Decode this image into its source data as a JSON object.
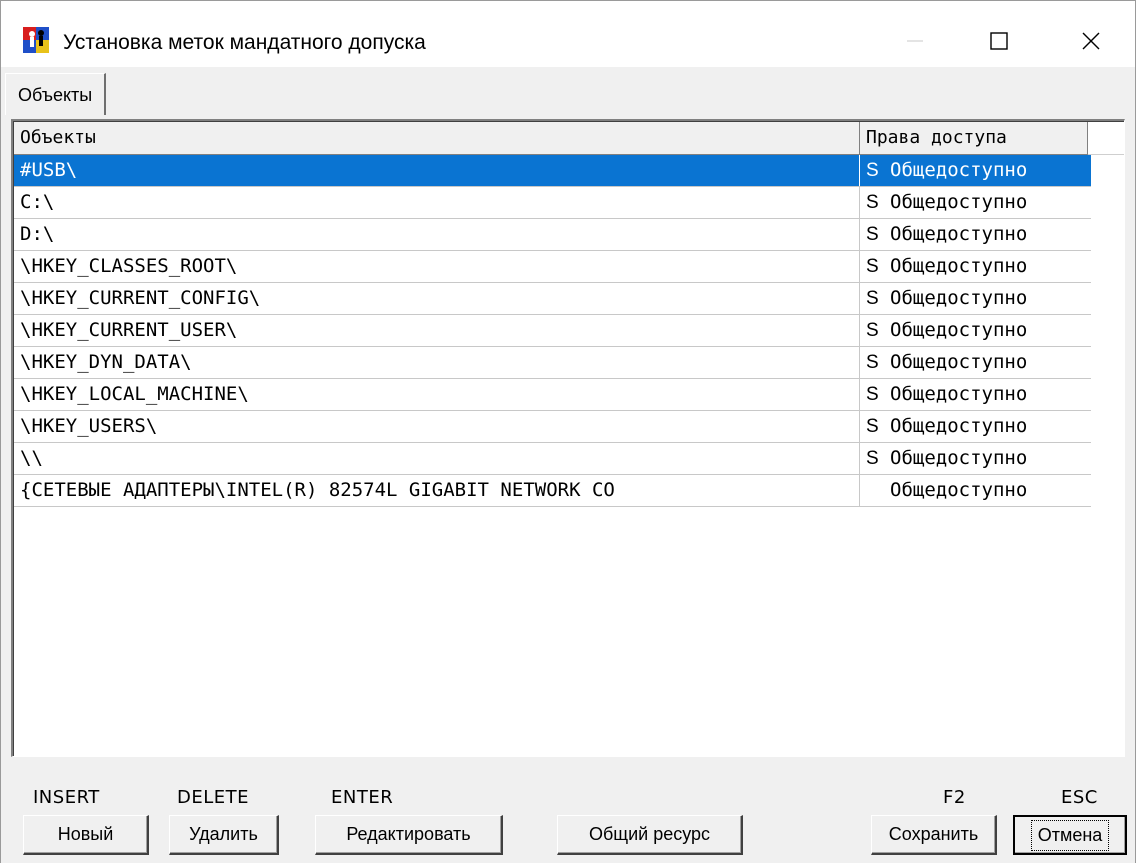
{
  "window": {
    "title": "Установка меток мандатного допуска"
  },
  "tabs": [
    {
      "label": "Объекты",
      "active": true
    }
  ],
  "grid": {
    "columns": {
      "objects": "Объекты",
      "rights": "Права доступа"
    },
    "rows": [
      {
        "object": "#USB\\",
        "flag": "S",
        "rights": "Общедоступно",
        "selected": true
      },
      {
        "object": "C:\\",
        "flag": "S",
        "rights": "Общедоступно"
      },
      {
        "object": "D:\\",
        "flag": "S",
        "rights": "Общедоступно"
      },
      {
        "object": "\\HKEY_CLASSES_ROOT\\",
        "flag": "S",
        "rights": "Общедоступно"
      },
      {
        "object": "\\HKEY_CURRENT_CONFIG\\",
        "flag": "S",
        "rights": "Общедоступно"
      },
      {
        "object": "\\HKEY_CURRENT_USER\\",
        "flag": "S",
        "rights": "Общедоступно"
      },
      {
        "object": "\\HKEY_DYN_DATA\\",
        "flag": "S",
        "rights": "Общедоступно"
      },
      {
        "object": "\\HKEY_LOCAL_MACHINE\\",
        "flag": "S",
        "rights": "Общедоступно"
      },
      {
        "object": "\\HKEY_USERS\\",
        "flag": "S",
        "rights": "Общедоступно"
      },
      {
        "object": "\\\\",
        "flag": "S",
        "rights": "Общедоступно"
      },
      {
        "object": "{СЕТЕВЫЕ АДАПТЕРЫ\\INTEL(R) 82574L GIGABIT NETWORK CO",
        "flag": "",
        "rights": "Общедоступно"
      }
    ]
  },
  "bottom": {
    "keys": {
      "insert": "INSERT",
      "delete": "DELETE",
      "enter": "ENTER",
      "f2": "F2",
      "esc": "ESC"
    },
    "buttons": {
      "new": "Новый",
      "delete": "Удалить",
      "edit": "Редактировать",
      "shared": "Общий ресурс",
      "save": "Сохранить",
      "cancel": "Отмена"
    }
  },
  "colors": {
    "selection": "#0a74d2",
    "face": "#f0f0f0"
  }
}
